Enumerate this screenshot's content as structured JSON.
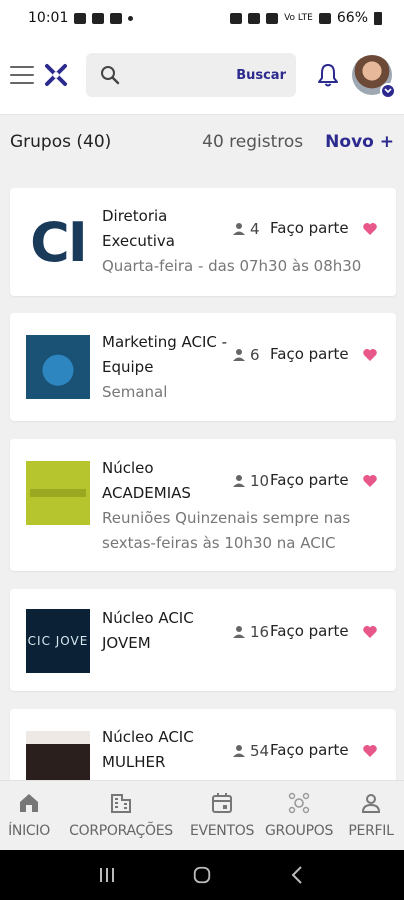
{
  "status_bar": {
    "time": "10:01",
    "battery": "66%",
    "network": "Vo LTE"
  },
  "header": {
    "search": {
      "placeholder": "",
      "button_label": "Buscar"
    }
  },
  "toolbar": {
    "title": "Grupos (40)",
    "records": "40 registros",
    "new_label": "Novo +"
  },
  "groups": [
    {
      "name": "Diretoria Executiva",
      "members": "4",
      "join_label": "Faço parte",
      "description": "Quarta-feira - das 07h30 às 08h30",
      "thumb_text": "CI"
    },
    {
      "name": "Marketing ACIC - Equipe",
      "members": "6",
      "join_label": "Faço parte",
      "description": "Semanal"
    },
    {
      "name": "Núcleo ACADEMIAS",
      "members": "10",
      "join_label": "Faço parte",
      "description": "Reuniões Quinzenais sempre nas sextas-feiras às 10h30 na ACIC"
    },
    {
      "name": "Núcleo ACIC JOVEM",
      "members": "16",
      "join_label": "Faço parte",
      "description": "",
      "thumb_text": "CIC JOVE"
    },
    {
      "name": "Núcleo ACIC MULHER",
      "members": "54",
      "join_label": "Faço parte",
      "description": ""
    }
  ],
  "bottom_nav": [
    {
      "label": "ÍNICIO",
      "icon": "home-icon"
    },
    {
      "label": "CORPORAÇÕES",
      "icon": "building-icon"
    },
    {
      "label": "EVENTOS",
      "icon": "calendar-icon"
    },
    {
      "label": "GROUPOS",
      "icon": "group-icon"
    },
    {
      "label": "PERFIL",
      "icon": "person-icon"
    }
  ],
  "colors": {
    "accent": "#2d2a8f",
    "heart": "#e8578a",
    "text_muted": "#777777",
    "background": "#f0f0f0"
  }
}
